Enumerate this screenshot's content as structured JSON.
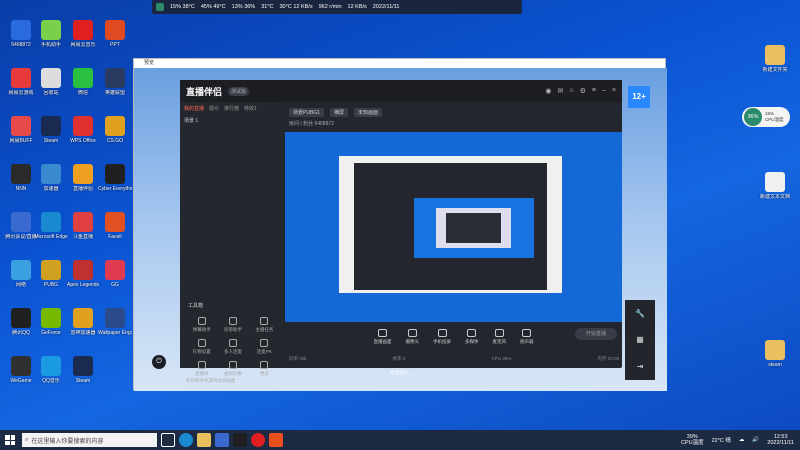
{
  "desktop": {
    "left_icons": [
      {
        "label": "6468872",
        "color": "#2a6adf"
      },
      {
        "label": "网易云游戏",
        "color": "#e83a3a"
      },
      {
        "label": "网易BUFF",
        "color": "#e84a4a"
      },
      {
        "label": "NNN",
        "color": "#2a2a2a"
      },
      {
        "label": "腾讯会议/直播",
        "color": "#3a6ad0"
      },
      {
        "label": "网络",
        "color": "#3aa0e0"
      },
      {
        "label": "腾讯QQ",
        "color": "#202020"
      },
      {
        "label": "WeGame",
        "color": "#303030"
      },
      {
        "label": "手机助手",
        "color": "#7ad04a"
      },
      {
        "label": "回收站",
        "color": "#dddddd"
      },
      {
        "label": "Steam",
        "color": "#1a2a50"
      },
      {
        "label": "加速器",
        "color": "#3a8ad0"
      },
      {
        "label": "Microsoft Edge",
        "color": "#1a8ad0"
      },
      {
        "label": "PUBG",
        "color": "#d0a020"
      },
      {
        "label": "GeForce",
        "color": "#76b900"
      },
      {
        "label": "QQ音乐",
        "color": "#1a9ae0"
      },
      {
        "label": "网易云音乐",
        "color": "#e02020"
      },
      {
        "label": "微信",
        "color": "#2ac040"
      },
      {
        "label": "WPS Office",
        "color": "#e03030"
      },
      {
        "label": "直播伴侣",
        "color": "#f0a020"
      },
      {
        "label": "斗鱼直播",
        "color": "#e04040"
      },
      {
        "label": "Apex Legends",
        "color": "#c03030"
      },
      {
        "label": "雷神加速器",
        "color": "#e0a020"
      },
      {
        "label": "Steam",
        "color": "#1a2a50"
      },
      {
        "label": "PPT",
        "color": "#e04a20"
      },
      {
        "label": "英雄联盟",
        "color": "#2a3a60"
      },
      {
        "label": "CS:GO",
        "color": "#e0a020"
      },
      {
        "label": "Cyber Everything",
        "color": "#202020"
      },
      {
        "label": "Faceit",
        "color": "#e05020"
      },
      {
        "label": "GG",
        "color": "#e03a50"
      },
      {
        "label": "Wallpaper Engine",
        "color": "#2a4a8a"
      }
    ],
    "right_icons": [
      {
        "label": "新建文件夹",
        "color": "#e8c060"
      },
      {
        "label": "新建文本文档",
        "color": "#f0f0f0"
      },
      {
        "label": "steam",
        "color": "#e8c060"
      }
    ]
  },
  "monitor_bar": {
    "stats": [
      "15% 38°C",
      "45% 49°C",
      "13% 36%",
      "31°C",
      "30°C 12 KB/s",
      "962 r/min",
      "12 KB/s"
    ],
    "datetime": "2022/11/11"
  },
  "outer_window": {
    "title": "预览"
  },
  "app": {
    "logo": "直播伴侣",
    "version": "测试版",
    "tabs": [
      "我的直播",
      "观众",
      "排行榜",
      "特效1"
    ],
    "scene": "场景 1",
    "top_fields": [
      "场景PUBG1",
      "横屏",
      "未知画面"
    ],
    "room_info": "房间 | 粉丝 6468872",
    "tools_title": "工具箱",
    "tools": [
      "弹幕助手",
      "房管助手",
      "主播任务",
      "礼物设置",
      "多人连麦",
      "连麦PK",
      "直播间",
      "虚拟形象",
      "更多"
    ],
    "hint": "如何把手机游戏投屏画面",
    "preview_buttons": [
      "直播画面",
      "摄像头",
      "手机投屏",
      "多媒体",
      "麦克风",
      "扬声器"
    ],
    "start_button": "开始直播",
    "status": [
      "码率 0kb",
      "帧率 0",
      "CPU 36%",
      "内存 00:00"
    ]
  },
  "bottom_strip": "点击进入",
  "badge": "12+",
  "cpu_widget": {
    "percent": "36%",
    "line1": "15%",
    "line2": "CPU温度"
  },
  "taskbar": {
    "search_placeholder": "在这里输入你要搜索的内容",
    "cpu": "CPU温度",
    "cpu_value": "39%",
    "weather": "22°C 晴",
    "time": "12:53",
    "date": "2022/11/11"
  }
}
